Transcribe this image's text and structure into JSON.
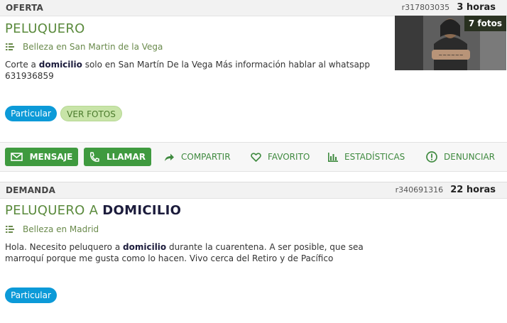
{
  "ads": [
    {
      "type": "OFERTA",
      "ref": "r317803035",
      "time": "3 horas",
      "title": "PELUQUERO",
      "category": "Belleza en San Martin de la Vega",
      "desc_pre": "Corte a ",
      "desc_bold": "domicilio",
      "desc_post": " solo en San Martín De la Vega Más información hablar al whatsapp 631936859",
      "badge": "Particular",
      "photos_button": "VER FOTOS",
      "photo_count": "7 fotos"
    },
    {
      "type": "DEMANDA",
      "ref": "r340691316",
      "time": "22 horas",
      "title_pre": "PELUQUERO A ",
      "title_bold": "DOMICILIO",
      "category": "Belleza en Madrid",
      "desc_pre": "Hola. Necesito peluquero a ",
      "desc_bold": "domicilio",
      "desc_post": " durante la cuarentena. A ser posible, que sea marroquí porque me gusta como lo hacen. Vivo cerca del Retiro y de Pacífico",
      "badge": "Particular"
    }
  ],
  "actions": {
    "message": "MENSAJE",
    "call": "LLAMAR",
    "share": "COMPARTIR",
    "favorite": "FAVORITO",
    "stats": "ESTADÍSTICAS",
    "report": "DENUNCIAR"
  },
  "colors": {
    "title_green": "#5a8a3c",
    "action_green": "#3f9a3f",
    "badge_blue": "#0c9ad8",
    "photos_green": "#c8e4a8"
  },
  "icons": [
    "list-icon",
    "envelope-icon",
    "phone-icon",
    "share-arrow-icon",
    "heart-icon",
    "bar-chart-icon",
    "alert-circle-icon"
  ]
}
